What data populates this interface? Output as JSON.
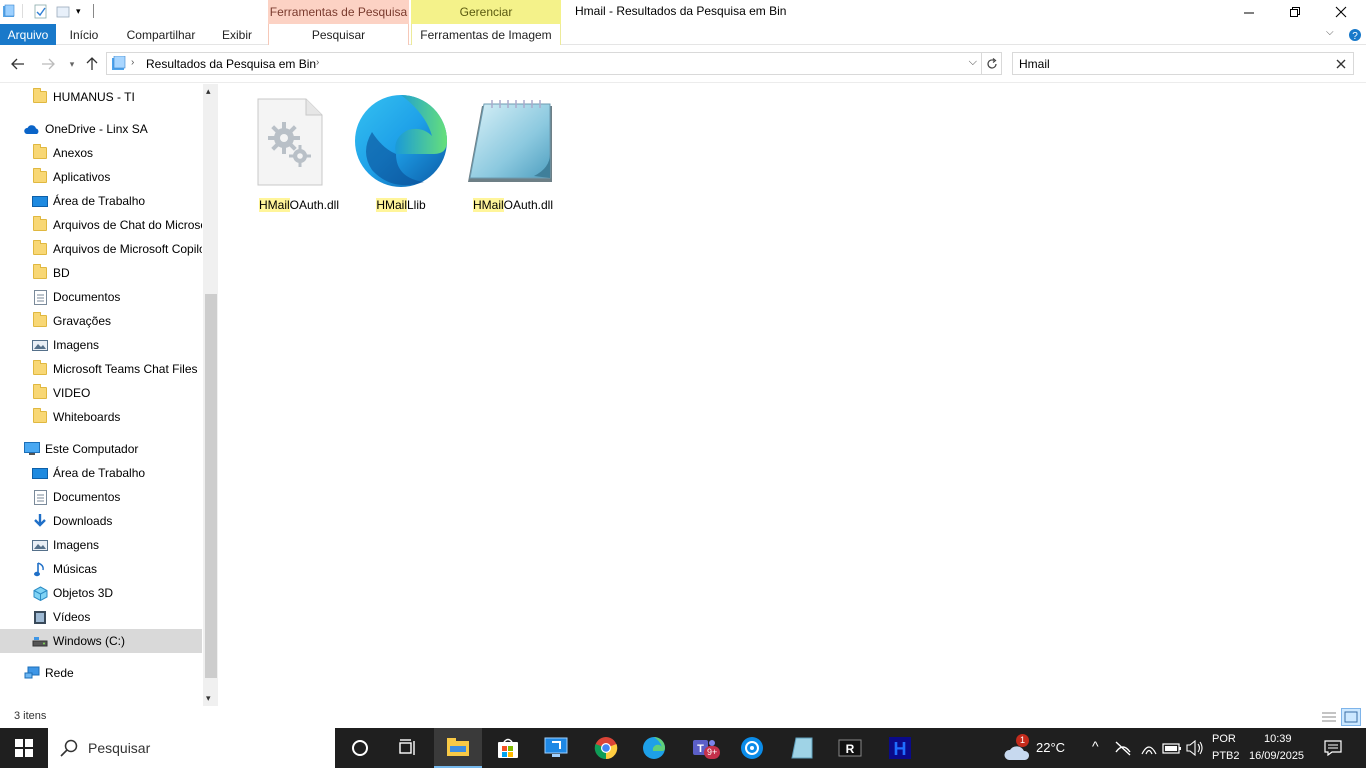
{
  "window": {
    "title": "Hmail - Resultados da Pesquisa em Bin",
    "contextual_tab_search": "Ferramentas de Pesquisa",
    "contextual_tab_manage": "Gerenciar"
  },
  "ribbon": {
    "tabs": [
      "Arquivo",
      "Início",
      "Compartilhar",
      "Exibir",
      "Pesquisar",
      "Ferramentas de Imagem"
    ]
  },
  "address": {
    "breadcrumb": "Resultados da Pesquisa em Bin",
    "search_value": "Hmail"
  },
  "nav": {
    "items": [
      {
        "label": "HUMANUS - TI",
        "icon": "folder-icon"
      },
      {
        "label": "OneDrive - Linx SA",
        "icon": "onedrive-icon"
      },
      {
        "label": "Anexos",
        "icon": "folder-icon"
      },
      {
        "label": "Aplicativos",
        "icon": "folder-icon"
      },
      {
        "label": "Área de Trabalho",
        "icon": "desktop-icon"
      },
      {
        "label": "Arquivos de Chat do Microsoft",
        "icon": "folder-icon"
      },
      {
        "label": "Arquivos de Microsoft Copilot",
        "icon": "folder-icon"
      },
      {
        "label": "BD",
        "icon": "folder-icon"
      },
      {
        "label": "Documentos",
        "icon": "documents-icon"
      },
      {
        "label": "Gravações",
        "icon": "folder-icon"
      },
      {
        "label": "Imagens",
        "icon": "pictures-icon"
      },
      {
        "label": "Microsoft Teams Chat Files",
        "icon": "folder-icon"
      },
      {
        "label": "VIDEO",
        "icon": "folder-icon"
      },
      {
        "label": "Whiteboards",
        "icon": "folder-icon"
      },
      {
        "label": "Este Computador",
        "icon": "computer-icon"
      },
      {
        "label": "Área de Trabalho",
        "icon": "desktop-icon"
      },
      {
        "label": "Documentos",
        "icon": "documents-icon"
      },
      {
        "label": "Downloads",
        "icon": "downloads-icon"
      },
      {
        "label": "Imagens",
        "icon": "pictures-icon"
      },
      {
        "label": "Músicas",
        "icon": "music-icon"
      },
      {
        "label": "Objetos 3D",
        "icon": "objects3d-icon"
      },
      {
        "label": "Vídeos",
        "icon": "videos-icon"
      },
      {
        "label": "Windows (C:)",
        "icon": "drive-icon"
      },
      {
        "label": "Rede",
        "icon": "network-icon"
      }
    ]
  },
  "files": [
    {
      "highlight": "HMail",
      "rest": "OAuth.dll",
      "icon": "dll-gear-icon"
    },
    {
      "highlight": "HMail",
      "rest": "Llib",
      "icon": "edge-icon"
    },
    {
      "highlight": "HMail",
      "rest": "OAuth.dll",
      "icon": "notepad-icon"
    }
  ],
  "status": {
    "count": "3 itens"
  },
  "taskbar": {
    "search_placeholder": "Pesquisar",
    "weather_temp": "22°C",
    "weather_badge": "1",
    "teams_badge": "9+",
    "lang_top": "POR",
    "lang_bottom": "PTB2",
    "time": "10:39",
    "date": "16/09/2025"
  },
  "colors": {
    "accent": "#1979ca",
    "search_context": "#fcd2c4",
    "manage_context": "#f4f28a",
    "highlight": "#fff59a",
    "taskbar": "#1f1f1f"
  }
}
